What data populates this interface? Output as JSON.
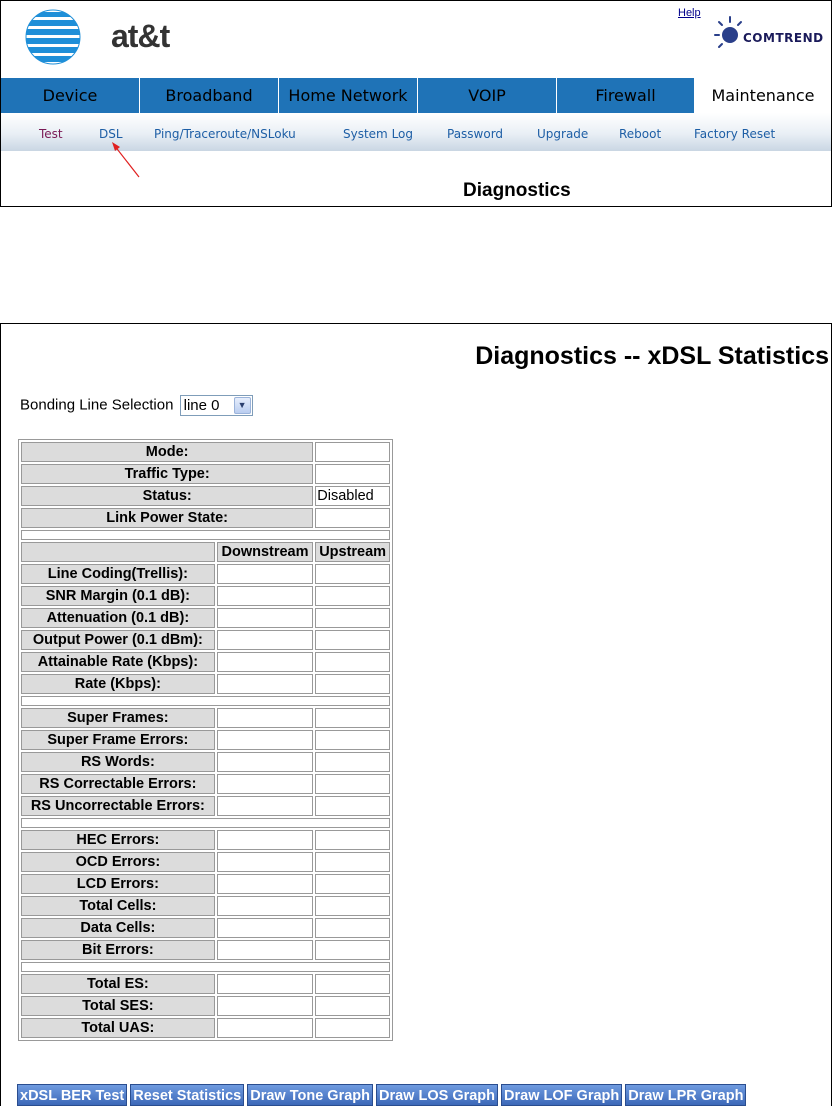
{
  "header": {
    "brand": "at&t",
    "help": "Help",
    "vendor": "COMTREND",
    "nav_tabs": [
      "Device",
      "Broadband",
      "Home Network",
      "VOIP",
      "Firewall",
      "Maintenance"
    ],
    "active_tab": "Maintenance",
    "subnav": [
      "Test",
      "DSL",
      "Ping/Traceroute/NSLoku",
      "System Log",
      "Password",
      "Upgrade",
      "Reboot",
      "Factory Reset"
    ],
    "section_title": "Diagnostics"
  },
  "page": {
    "title": "Diagnostics -- xDSL Statistics",
    "bonding_label": "Bonding Line Selection",
    "bonding_value": "line 0"
  },
  "stats": {
    "mode": "Mode:",
    "traffic_type": "Traffic Type:",
    "status": "Status:",
    "status_value": "Disabled",
    "link_power_state": "Link Power State:",
    "col_downstream": "Downstream",
    "col_upstream": "Upstream",
    "line_coding": "Line Coding(Trellis):",
    "snr_margin": "SNR Margin (0.1 dB):",
    "attenuation": "Attenuation (0.1 dB):",
    "output_power": "Output Power (0.1 dBm):",
    "attainable_rate": "Attainable Rate (Kbps):",
    "rate": "Rate (Kbps):",
    "super_frames": "Super Frames:",
    "super_frame_errors": "Super Frame Errors:",
    "rs_words": "RS Words:",
    "rs_correctable": "RS Correctable Errors:",
    "rs_uncorrectable": "RS Uncorrectable Errors:",
    "hec_errors": "HEC Errors:",
    "ocd_errors": "OCD Errors:",
    "lcd_errors": "LCD Errors:",
    "total_cells": "Total Cells:",
    "data_cells": "Data Cells:",
    "bit_errors": "Bit Errors:",
    "total_es": "Total ES:",
    "total_ses": "Total SES:",
    "total_uas": "Total UAS:"
  },
  "buttons": {
    "ber_test": "xDSL BER Test",
    "reset": "Reset Statistics",
    "tone": "Draw Tone Graph",
    "los": "Draw LOS Graph",
    "lof": "Draw LOF Graph",
    "lpr": "Draw LPR Graph"
  },
  "colors": {
    "nav_blue": "#1f73b7",
    "button_blue": "#4a78c8",
    "label_gray": "#dcdcdc",
    "link_blue": "#1d5ea5"
  }
}
